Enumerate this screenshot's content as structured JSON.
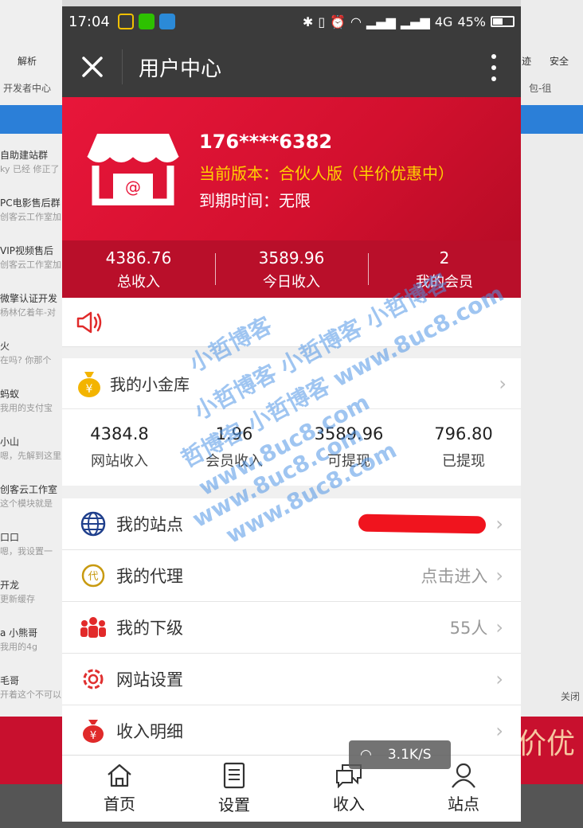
{
  "background": {
    "bookmarks": [
      "解析",
      "迹",
      "安全"
    ],
    "tab_label": "开发者中心",
    "tab_right": "包-徂",
    "sidebar_rows": [
      {
        "title": "自助建站群",
        "sub": "ky 已经 修正了"
      },
      {
        "title": "PC电影售后群",
        "sub": "创客云工作室加"
      },
      {
        "title": "VIP视频售后",
        "sub": "创客云工作室加"
      },
      {
        "title": "微擎认证开发",
        "sub": "杨林亿着年-对"
      },
      {
        "title": "火",
        "sub": "在吗? 你那个"
      },
      {
        "title": "蚂蚁",
        "sub": "我用的支付宝"
      },
      {
        "title": "小山",
        "sub": "嗯，先解到这里"
      },
      {
        "title": "创客云工作室",
        "sub": "这个模块就是"
      },
      {
        "title": "口口",
        "sub": "嗯，我设置一"
      },
      {
        "title": "开龙",
        "sub": "更新缓存"
      },
      {
        "title": "a 小熊哥",
        "sub": "我用的4g"
      },
      {
        "title": "毛哥",
        "sub": "开着这个不可以"
      }
    ],
    "right_bottom_text": "半价优",
    "right_button": "关闭"
  },
  "statusbar": {
    "time": "17:04",
    "network": "4G",
    "battery": "45%"
  },
  "titlebar": {
    "title": "用户中心"
  },
  "hero": {
    "phone": "176****6382",
    "version": "当前版本：合伙人版（半价优惠中）",
    "expire": "到期时间：无限"
  },
  "stats": [
    {
      "value": "4386.76",
      "label": "总收入"
    },
    {
      "value": "3589.96",
      "label": "今日收入"
    },
    {
      "value": "2",
      "label": "我的会员"
    }
  ],
  "vault": {
    "title": "我的小金库",
    "stats": [
      {
        "value": "4384.8",
        "label": "网站收入"
      },
      {
        "value": "1.96",
        "label": "会员收入"
      },
      {
        "value": "3589.96",
        "label": "可提现"
      },
      {
        "value": "796.80",
        "label": "已提现"
      }
    ]
  },
  "menu": {
    "sites": {
      "label": "我的站点"
    },
    "agent": {
      "label": "我的代理",
      "value": "点击进入"
    },
    "subs": {
      "label": "我的下级",
      "value": "55人"
    },
    "settings": {
      "label": "网站设置"
    },
    "income": {
      "label": "收入明细"
    }
  },
  "tabbar": {
    "home": "首页",
    "settings": "设置",
    "income": "收入",
    "site": "站点"
  },
  "speed": "3.1K/S",
  "watermarks": [
    "小哲博客",
    "小哲博客 小哲博客 小哲博客",
    "哲博客 小哲博客 www.8uc8.com",
    "www.8uc8.com",
    "www.8uc8.com",
    "www.8uc8.com"
  ],
  "colors": {
    "hero_red": "#e8163a",
    "stats_red": "#b90f2a",
    "version_yellow": "#ffd200",
    "dark_bar": "#3b3b3b"
  }
}
